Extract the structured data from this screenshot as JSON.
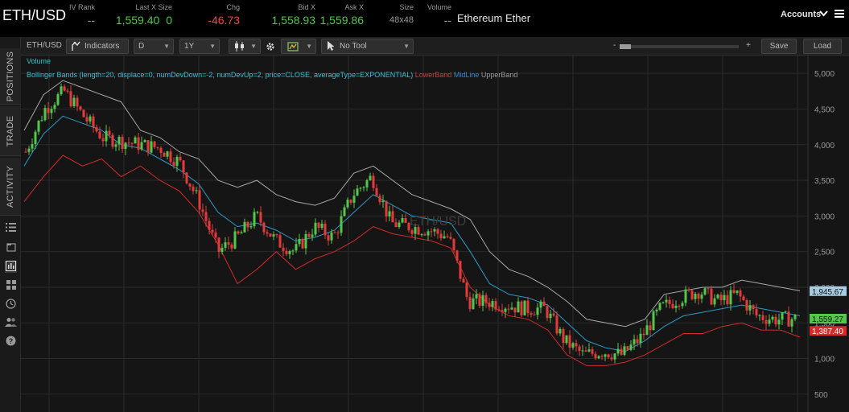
{
  "header": {
    "symbol": "ETH/USD",
    "iv_rank": {
      "label": "IV Rank",
      "value": "--"
    },
    "last": {
      "label": "Last X Size",
      "value": "1,559.40",
      "size": "0"
    },
    "chg": {
      "label": "Chg",
      "value": "-46.73"
    },
    "bid": {
      "label": "Bid X",
      "value": "1,558.93"
    },
    "ask": {
      "label": "Ask X",
      "value": "1,559.86"
    },
    "size": {
      "label": "Size",
      "value": "48x48"
    },
    "volume": {
      "label": "Volume",
      "value": "--"
    },
    "description": "Ethereum Ether",
    "accounts": "Accounts",
    "chevron_icon": "chevron-down-icon",
    "menu_icon": "menu-icon"
  },
  "left_tabs": {
    "tabs": [
      "POSITIONS",
      "TRADE",
      "ACTIVITY"
    ],
    "icons": [
      "list-icon",
      "page-icon",
      "chart-icon",
      "grid-icon",
      "clock-icon",
      "users-icon",
      "help-icon"
    ]
  },
  "toolbar": {
    "symbol": "ETH/USD",
    "indicators": "Indicators",
    "aggregation": "D",
    "timeframe": "1Y",
    "drawing_tool": "No Tool",
    "zoom_minus": "-",
    "zoom_plus": "+",
    "save": "Save",
    "load": "Load"
  },
  "chart": {
    "legend_volume": "Volume",
    "study_text": "Bollinger Bands (length=20, displace=0, numDevDown=-2, numDevUp=2, price=CLOSE, averageType=EXPONENTIAL)",
    "lower_label": "LowerBand",
    "mid_label": "MidLine",
    "upper_label": "UpperBand",
    "watermark": "ETH/USD",
    "colors": {
      "up": "#54c64b",
      "down": "#e23b3b",
      "upper": "#a8a8a8",
      "mid": "#2b9ac7",
      "lower": "#d42a2a",
      "grid": "#2a2a2a"
    }
  },
  "chart_data": {
    "type": "line",
    "title": "",
    "xlabel": "",
    "ylabel": "",
    "ylim": [
      250,
      5250
    ],
    "y_ticks": [
      500,
      1000,
      1500,
      2000,
      2500,
      3000,
      3500,
      4000,
      4500,
      5000
    ],
    "y_tick_labels": [
      "500",
      "1,000",
      "1,500",
      "2,000",
      "2,500",
      "3,000",
      "3,500",
      "4,000",
      "4,500",
      "5,000"
    ],
    "price_tags": [
      {
        "series": "UpperBand",
        "value": 1945.67,
        "text": "1,945.67",
        "color": "#a8cbe0"
      },
      {
        "series": "Close",
        "value": 1559.27,
        "text": "1,559.27",
        "color": "#54c64b"
      },
      {
        "series": "LowerBand",
        "value": 1387.4,
        "text": "1,387.40",
        "color": "#d42a2a"
      }
    ],
    "x": [
      0,
      5,
      10,
      15,
      20,
      25,
      30,
      35,
      40,
      45,
      50,
      55,
      60,
      65,
      70,
      75,
      80,
      85,
      90,
      95,
      100,
      105,
      110,
      115,
      120,
      125,
      130,
      135,
      140,
      145,
      150,
      155,
      160,
      165,
      170,
      175,
      180,
      185,
      190,
      195,
      200
    ],
    "series": [
      {
        "name": "UpperBand",
        "values": [
          4200,
          4700,
          4900,
          4800,
          4700,
          4600,
          4200,
          4100,
          3900,
          3800,
          3500,
          3400,
          3500,
          3300,
          3200,
          3150,
          3250,
          3600,
          3700,
          3500,
          3300,
          3200,
          3100,
          2950,
          2500,
          2250,
          2150,
          2000,
          1800,
          1550,
          1500,
          1450,
          1550,
          1900,
          1950,
          2000,
          2000,
          2100,
          2050,
          2000,
          1950
        ]
      },
      {
        "name": "MidLine",
        "values": [
          3700,
          4150,
          4400,
          4300,
          4200,
          4000,
          3950,
          3800,
          3650,
          3450,
          3050,
          2850,
          2900,
          2800,
          2650,
          2700,
          2800,
          3050,
          3300,
          3150,
          3000,
          2950,
          2900,
          2500,
          2050,
          1900,
          1850,
          1750,
          1500,
          1250,
          1150,
          1100,
          1250,
          1450,
          1600,
          1650,
          1700,
          1750,
          1700,
          1650,
          1600
        ]
      },
      {
        "name": "LowerBand",
        "values": [
          3200,
          3550,
          3850,
          3700,
          3800,
          3550,
          3700,
          3500,
          3350,
          3050,
          2600,
          2050,
          2250,
          2500,
          2250,
          2400,
          2500,
          2650,
          2850,
          2750,
          2700,
          2650,
          2550,
          2000,
          1750,
          1600,
          1550,
          1400,
          1050,
          900,
          900,
          950,
          1050,
          1200,
          1350,
          1350,
          1450,
          1500,
          1400,
          1400,
          1300
        ]
      },
      {
        "name": "Close",
        "values": [
          3900,
          4500,
          4750,
          4400,
          4100,
          4050,
          4000,
          3950,
          3750,
          3200,
          2500,
          2700,
          3000,
          2650,
          2500,
          2850,
          2700,
          3300,
          3550,
          2900,
          2850,
          2800,
          2700,
          1800,
          1800,
          1750,
          1700,
          1700,
          1250,
          1050,
          1100,
          1050,
          1300,
          1700,
          1850,
          1950,
          1800,
          1900,
          1600,
          1550,
          1559
        ]
      }
    ]
  }
}
